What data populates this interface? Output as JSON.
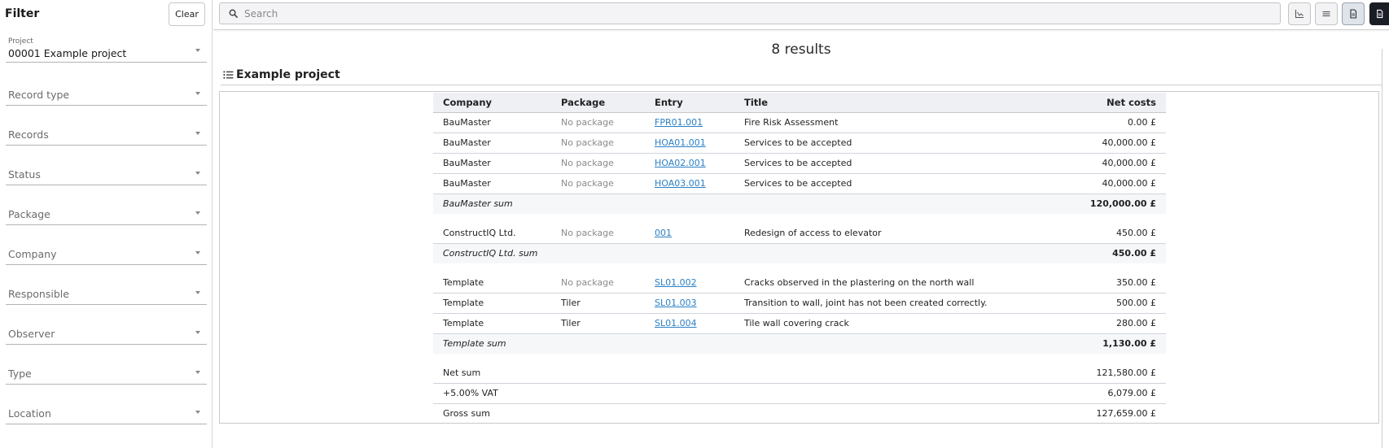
{
  "sidebar": {
    "title": "Filter",
    "clear_label": "Clear",
    "project": {
      "label": "Project",
      "value": "00001 Example project"
    },
    "filters": [
      {
        "label": "Record type"
      },
      {
        "label": "Records"
      },
      {
        "label": "Status"
      },
      {
        "label": "Package"
      },
      {
        "label": "Company"
      },
      {
        "label": "Responsible"
      },
      {
        "label": "Observer"
      },
      {
        "label": "Type"
      },
      {
        "label": "Location"
      }
    ]
  },
  "search": {
    "placeholder": "Search"
  },
  "view_buttons": [
    {
      "icon": "chart-icon",
      "active": false
    },
    {
      "icon": "list-icon",
      "active": false
    },
    {
      "icon": "report-icon",
      "active": true
    },
    {
      "icon": "pdf-export-icon",
      "active": false
    }
  ],
  "main": {
    "results_text": "8 results",
    "section_title": "Example project",
    "table": {
      "headers": {
        "company": "Company",
        "package": "Package",
        "entry": "Entry",
        "title": "Title",
        "net_costs": "Net costs"
      },
      "groups": [
        {
          "rows": [
            {
              "company": "BauMaster",
              "package": "No package",
              "entry": "FPR01.001",
              "title": "Fire Risk Assessment",
              "net": "0.00 £"
            },
            {
              "company": "BauMaster",
              "package": "No package",
              "entry": "HOA01.001",
              "title": "Services to be accepted",
              "net": "40,000.00 £"
            },
            {
              "company": "BauMaster",
              "package": "No package",
              "entry": "HOA02.001",
              "title": "Services to be accepted",
              "net": "40,000.00 £"
            },
            {
              "company": "BauMaster",
              "package": "No package",
              "entry": "HOA03.001",
              "title": "Services to be accepted",
              "net": "40,000.00 £"
            }
          ],
          "sum_label": "BauMaster sum",
          "sum_value": "120,000.00 £"
        },
        {
          "rows": [
            {
              "company": "ConstructIQ Ltd.",
              "package": "No package",
              "entry": "001",
              "title": "Redesign of access to elevator",
              "net": "450.00 £"
            }
          ],
          "sum_label": "ConstructIQ Ltd. sum",
          "sum_value": "450.00 £"
        },
        {
          "rows": [
            {
              "company": "Template",
              "package": "No package",
              "entry": "SL01.002",
              "title": "Cracks observed in the plastering on the north wall",
              "net": "350.00 £"
            },
            {
              "company": "Template",
              "package": "Tiler",
              "entry": "SL01.003",
              "title": "Transition to wall, joint has not been created correctly.",
              "net": "500.00 £"
            },
            {
              "company": "Template",
              "package": "Tiler",
              "entry": "SL01.004",
              "title": "Tile wall covering crack",
              "net": "280.00 £"
            }
          ],
          "sum_label": "Template sum",
          "sum_value": "1,130.00 £"
        }
      ],
      "totals": [
        {
          "label": "Net sum",
          "value": "121,580.00 £"
        },
        {
          "label": "+5.00% VAT",
          "value": "6,079.00 £"
        },
        {
          "label": "Gross sum",
          "value": "127,659.00 £"
        }
      ]
    }
  }
}
